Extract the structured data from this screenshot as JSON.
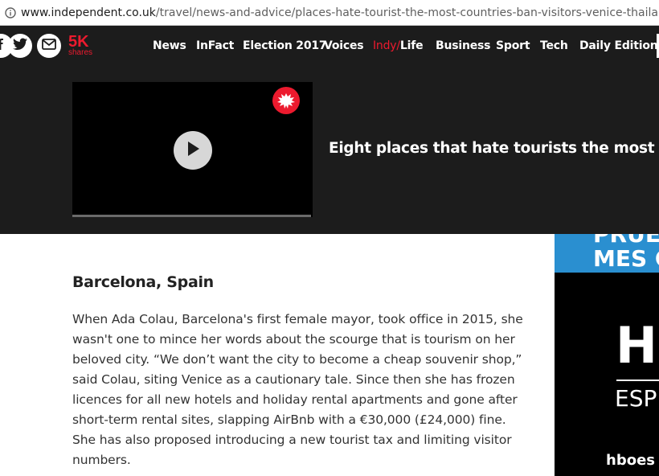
{
  "browser": {
    "url_host": "www.independent.co.uk",
    "url_path": "/travel/news-and-advice/places-hate-tourist-the-most-countries-ban-visitors-venice-thailand-amsterdam"
  },
  "share": {
    "count": "5K",
    "label": "shares",
    "icons": [
      "facebook-icon",
      "twitter-icon",
      "email-icon"
    ]
  },
  "nav": {
    "items": [
      {
        "label": "News"
      },
      {
        "label": "InFact"
      },
      {
        "label": "Election 2017"
      },
      {
        "label": "Voices"
      },
      {
        "label_red": "Indy/",
        "label": "Life"
      },
      {
        "label": "Business"
      },
      {
        "label": "Sport"
      },
      {
        "label": "Tech"
      },
      {
        "label": "Daily Edition"
      }
    ]
  },
  "video": {
    "title": "Eight places that hate tourists the most",
    "logo": "independent-eagle-icon",
    "play": "play-icon"
  },
  "article": {
    "heading": "Barcelona, Spain",
    "body": "When Ada Colau, Barcelona's first female mayor, took office in 2015, she wasn't one to mince her words about the scourge that is tourism on her beloved city. “We don’t want the city to become a cheap souvenir shop,” said Colau, siting Venice as a cautionary tale. Since then she has frozen licences for all new hotels and holiday rental apartments and gone after short-term rental sites, slapping AirBnb with a €30,000 (£24,000) fine. She has also proposed introducing a new tourist tax and limiting visitor numbers."
  },
  "ad": {
    "top_line1": "PRUE",
    "top_line2": "MES G",
    "brand": "HB",
    "sub": "ESP",
    "url": "hboes"
  },
  "colors": {
    "nav_bg": "#1c1c1c",
    "accent_red": "#ec1a2e",
    "ad_blue": "#2a8fd0"
  }
}
